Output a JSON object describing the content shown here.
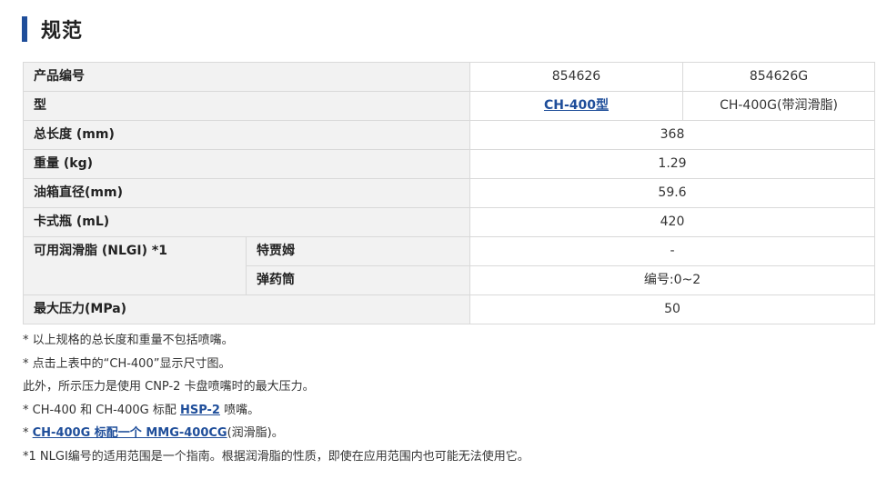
{
  "section": {
    "title": "规范"
  },
  "spec": {
    "product_no": {
      "label": "产品编号",
      "values": [
        "854626",
        "854626G"
      ]
    },
    "model": {
      "label": "型",
      "values": [
        "CH-400型",
        "CH-400G(带润滑脂)"
      ]
    },
    "length": {
      "label": "总长度 (mm)",
      "value": "368"
    },
    "weight": {
      "label": "重量 (kg)",
      "value": "1.29"
    },
    "tank_diameter": {
      "label": "油箱直径(mm)",
      "value": "59.6"
    },
    "cartridge": {
      "label": "卡式瓶 (mL)",
      "value": "420"
    },
    "grease": {
      "label": "可用润滑脂 (NLGI) *1",
      "sub1": {
        "label": "特贾姆",
        "value": "-"
      },
      "sub2": {
        "label": "弹药筒",
        "value": "编号:0~2"
      }
    },
    "max_pressure": {
      "label": "最大压力(MPa)",
      "value": "50"
    }
  },
  "notes": {
    "n1": "* 以上规格的总长度和重量不包括喷嘴。",
    "n2": "* 点击上表中的“CH-400”显示尺寸图。",
    "n3": "此外，所示压力是使用 CNP-2 卡盘喷嘴时的最大压力。",
    "n4": {
      "prefix": "* CH-400 和 CH-400G 标配 ",
      "link": "HSP-2",
      "suffix": " 喷嘴。"
    },
    "n5": {
      "prefix": "* ",
      "link": "CH-400G 标配一个 MMG-400CG",
      "suffix": "(润滑脂)。"
    },
    "n6": "*1 NLGI编号的适用范围是一个指南。根据润滑脂的性质，即使在应用范围内也可能无法使用它。"
  },
  "colors": {
    "accent": "#1f4e9a",
    "header_bg": "#f2f2f2",
    "border": "#d9d9d9"
  }
}
